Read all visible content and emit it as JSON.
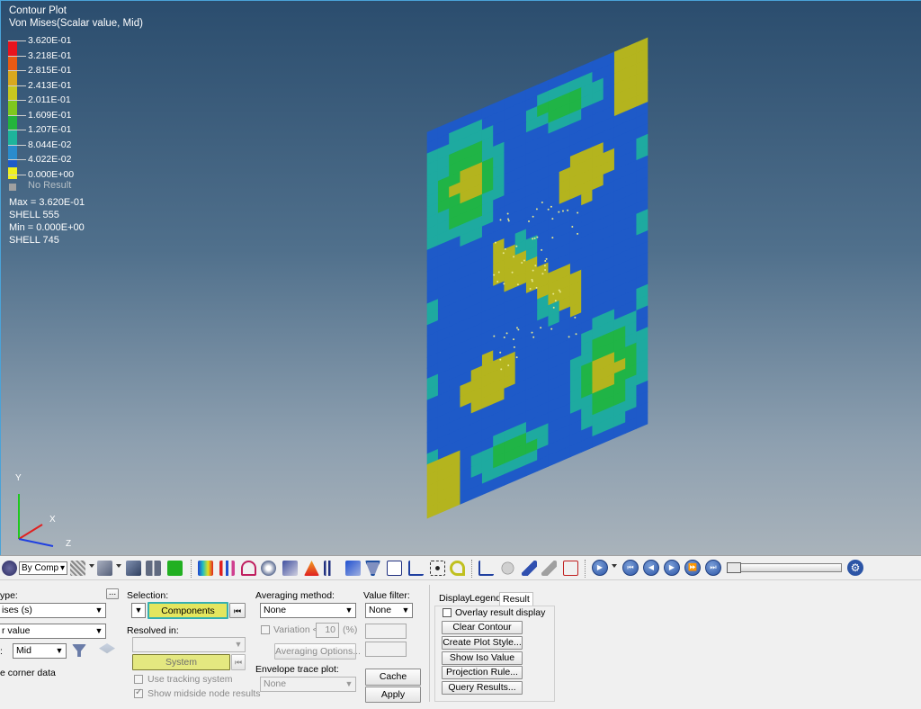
{
  "legend": {
    "title": "Contour Plot",
    "subtitle": "Von Mises(Scalar value, Mid)",
    "levels": [
      {
        "label": "3.620E-01",
        "color": "#e8141e"
      },
      {
        "label": "3.218E-01",
        "color": "#e85a14"
      },
      {
        "label": "2.815E-01",
        "color": "#d9a81e"
      },
      {
        "label": "2.413E-01",
        "color": "#c8c81e"
      },
      {
        "label": "2.011E-01",
        "color": "#7fc81e"
      },
      {
        "label": "1.609E-01",
        "color": "#23b43c"
      },
      {
        "label": "1.207E-01",
        "color": "#1eb49b"
      },
      {
        "label": "8.044E-02",
        "color": "#2a8ccd"
      },
      {
        "label": "4.022E-02",
        "color": "#1e5ac8"
      },
      {
        "label": "0.000E+00",
        "color": "#f0f01e"
      }
    ],
    "no_result": "No Result",
    "max_line": "Max = 3.620E-01",
    "max_element": "SHELL 555",
    "min_line": "Min = 0.000E+00",
    "min_element": "SHELL 745"
  },
  "plot_colors": {
    "blue": "#1e5ac8",
    "teal": "#1eaaa0",
    "green": "#20b446",
    "olive": "#b4b41e",
    "light_blue": "#2a8ccd"
  },
  "triad": {
    "y": "Y",
    "x": "X",
    "z": "Z"
  },
  "toolbar": {
    "by_comp": "By Comp"
  },
  "panel": {
    "result_type_label": "ype:",
    "result_type_value": "ises (s)",
    "scalar_value": "r value",
    "layer_label": ":",
    "layer_value": "Mid",
    "corner_data": "e corner data",
    "more_button": "...",
    "selection_label": "Selection:",
    "components_button": "Components",
    "resolved_label": "Resolved in:",
    "system_button": "System",
    "tracking_label": "Use tracking system",
    "midside_label": "Show midside node results",
    "averaging_label": "Averaging method:",
    "averaging_value": "None",
    "variation_label": "Variation <",
    "variation_value": "10",
    "variation_unit": "(%)",
    "averaging_options": "Averaging Options...",
    "envelope_label": "Envelope trace plot:",
    "envelope_value": "None",
    "value_filter_label": "Value filter:",
    "value_filter_value": "None",
    "cache_button": "Cache",
    "apply_button": "Apply",
    "tabs": [
      "Display",
      "Legend",
      "Result"
    ],
    "overlay_label": "Overlay result display",
    "clear_contour": "Clear Contour",
    "create_plot_style": "Create Plot Style...",
    "show_iso_value": "Show Iso Value",
    "projection_rule": "Projection Rule...",
    "query_results": "Query Results..."
  }
}
